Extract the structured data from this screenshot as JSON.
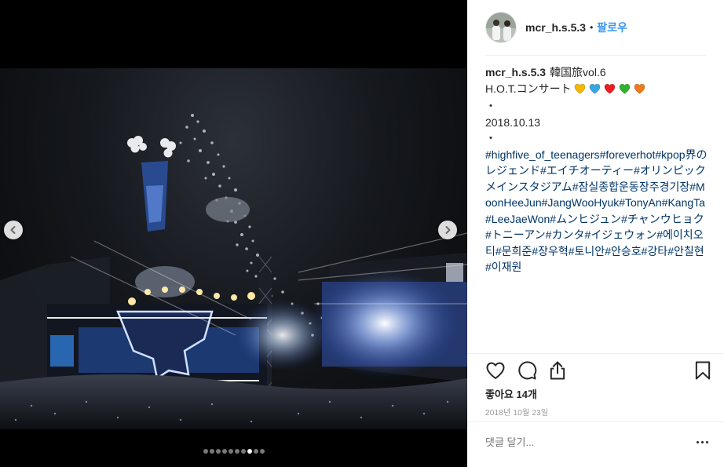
{
  "post": {
    "username": "mcr_h.s.5.3",
    "follow_label": "팔로우",
    "separator": "•"
  },
  "caption": {
    "username": "mcr_h.s.5.3",
    "line1": "韓国旅vol.6",
    "line2": "H.O.T.コンサート",
    "hearts": [
      "#f5b800",
      "#35a7e8",
      "#ed1c24",
      "#2db42d",
      "#f07a1a"
    ],
    "bullet": "・",
    "post_date": "2018.10.13",
    "hashtags": [
      "#highfive_of_teenagers",
      "#foreverhot",
      "#kpop界のレジェンド",
      "#エイチオーティー",
      "#オリンピックメインスタジアム",
      "#잠실종합운동장주경기장",
      "#MoonHeeJun",
      "#JangWooHyuk",
      "#TonyAn",
      "#KangTa",
      "#LeeJaeWon",
      "#ムンヒジュン",
      "#チャンウヒョク",
      "#トニーアン",
      "#カンタ",
      "#イジェウォン",
      "#에이치오티",
      "#문희준",
      "#장우혁",
      "#토니안",
      "#안승호",
      "#강타",
      "#안칠현",
      "#이재원"
    ]
  },
  "actions": {
    "like_icon": "heart-outline-icon",
    "comment_icon": "speech-bubble-icon",
    "share_icon": "share-icon",
    "save_icon": "bookmark-icon"
  },
  "likes_label": "좋아요 14개",
  "timestamp": "2018년 10월 23일",
  "comment": {
    "placeholder": "댓글 달기..."
  },
  "carousel": {
    "slide_count": 10,
    "active_index": 7
  },
  "colors": {
    "link": "#3897f0",
    "hashtag": "#003569",
    "muted": "#999999"
  }
}
